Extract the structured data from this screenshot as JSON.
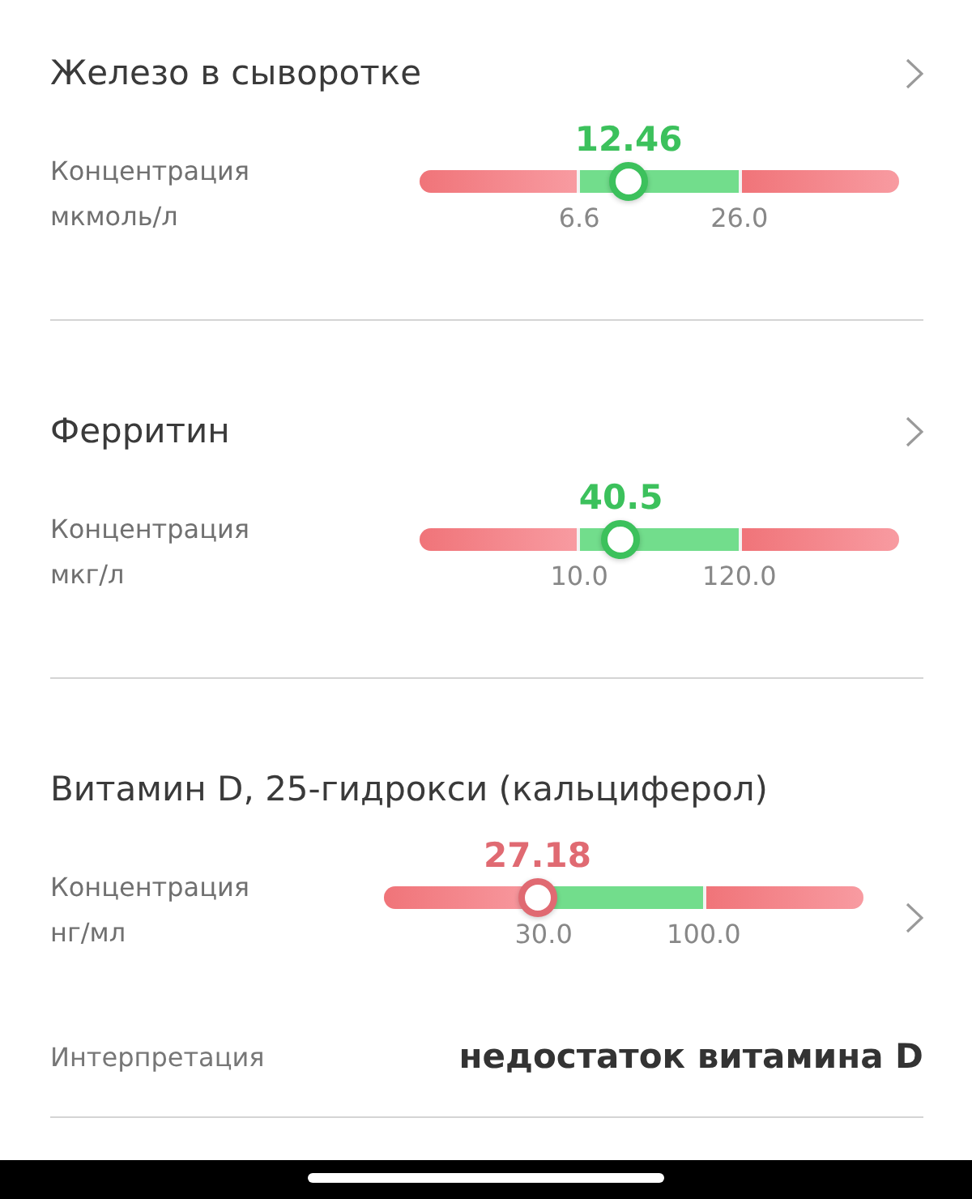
{
  "tests": [
    {
      "kind": "title-chevron",
      "title": "Железо в сыворотке",
      "label": "Концентрация",
      "unit": "мкмоль/л",
      "value": "12.46",
      "color": "#3cc15c",
      "level": 0.436,
      "low": "6.6",
      "high": "26.0"
    },
    {
      "kind": "title-chevron",
      "title": "Ферритин",
      "label": "Концентрация",
      "unit": "мкг/л",
      "value": "40.5",
      "color": "#3cc15c",
      "level": 0.42,
      "low": "10.0",
      "high": "120.0"
    },
    {
      "kind": "bar-chevron",
      "title": "Витамин D, 25-гидрокси (кальциферол)",
      "label": "Концентрация",
      "unit": "нг/мл",
      "value": "27.18",
      "color": "#e06a72",
      "level": 0.32,
      "low": "30.0",
      "high": "100.0",
      "interpretation": {
        "label": "Интерпретация",
        "value": "недостаток витамина D"
      }
    }
  ]
}
